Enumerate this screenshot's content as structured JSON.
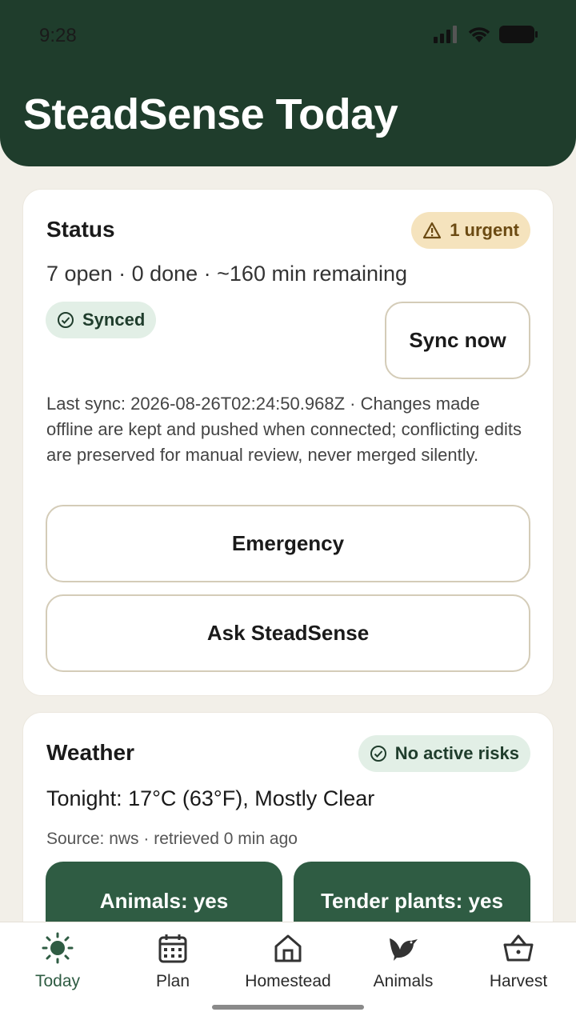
{
  "status_bar": {
    "time": "9:28"
  },
  "header": {
    "title": "SteadSense Today"
  },
  "status_card": {
    "title": "Status",
    "urgent_badge": "1 urgent",
    "summary": "7 open · 0 done · ~160 min remaining",
    "sync_badge": "Synced",
    "sync_button": "Sync now",
    "note": "Last sync: 2026-08-26T02:24:50.968Z · Changes made offline are kept and pushed when connected; conflicting edits are preserved for manual review, never merged silently.",
    "emergency_button": "Emergency",
    "ask_button": "Ask SteadSense"
  },
  "weather_card": {
    "title": "Weather",
    "risk_badge": "No active risks",
    "tonight": "Tonight: 17°C (63°F), Mostly Clear",
    "source": "Source: nws · retrieved 0 min ago",
    "tiles": [
      "Animals: yes",
      "Tender plants: yes"
    ]
  },
  "nav": {
    "active": "Today",
    "items": [
      {
        "label": "Today",
        "icon": "sun-icon"
      },
      {
        "label": "Plan",
        "icon": "calendar-icon"
      },
      {
        "label": "Homestead",
        "icon": "house-icon"
      },
      {
        "label": "Animals",
        "icon": "bird-icon"
      },
      {
        "label": "Harvest",
        "icon": "basket-icon"
      }
    ]
  },
  "colors": {
    "header": "#1f3d2c",
    "accent": "#2f5c43",
    "urgent": "#f5e3bd"
  }
}
